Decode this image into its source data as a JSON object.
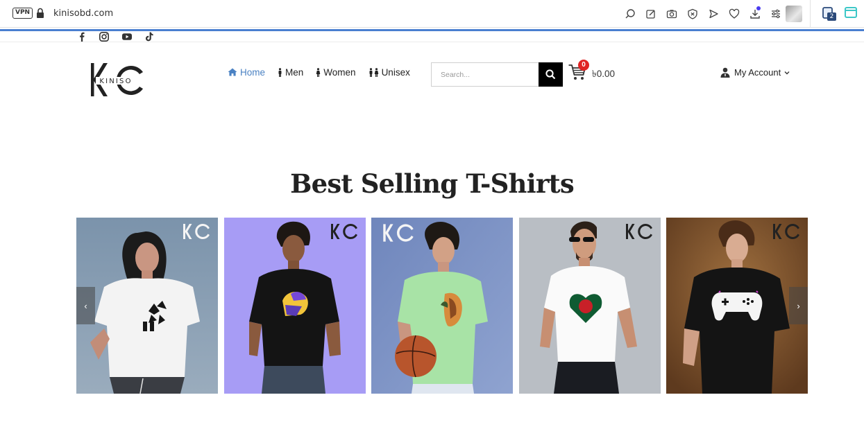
{
  "browser": {
    "vpn_label": "VPN",
    "url": "kinisobd.com",
    "tab_count": "2",
    "icons": [
      "search-page-icon",
      "edit-icon",
      "camera-icon",
      "shield-icon",
      "send-icon",
      "heart-icon",
      "download-icon",
      "settings-sliders-icon"
    ]
  },
  "social": [
    "facebook-icon",
    "instagram-icon",
    "youtube-icon",
    "tiktok-icon"
  ],
  "logo": {
    "text": "KINISO",
    "mark": "KO"
  },
  "nav": {
    "items": [
      {
        "label": "Home",
        "icon": "home-icon",
        "active": true
      },
      {
        "label": "Men",
        "icon": "man-icon",
        "active": false
      },
      {
        "label": "Women",
        "icon": "woman-icon",
        "active": false
      },
      {
        "label": "Unisex",
        "icon": "couple-icon",
        "active": false
      }
    ]
  },
  "search": {
    "placeholder": "Search..."
  },
  "cart": {
    "count": "0",
    "total": "৳0.00"
  },
  "account": {
    "label": "My Account"
  },
  "section": {
    "title": "Best Selling T-Shirts"
  },
  "products": [
    {
      "background": "#7f97ae",
      "shirt": "#f4f4f4",
      "graphic": "butterflies"
    },
    {
      "background": "#a79cf5",
      "shirt": "#151515",
      "graphic": "helmet"
    },
    {
      "background": "#7c93c4",
      "shirt": "#a8e3a6",
      "graphic": "tiger"
    },
    {
      "background": "#b9bec4",
      "shirt": "#fafafa",
      "graphic": "flag-heart"
    },
    {
      "background": "#8a5a33",
      "shirt": "#141414",
      "graphic": "gamepad"
    }
  ],
  "colors": {
    "accent": "#4b82c3",
    "badge": "#e02424",
    "dark": "#000000"
  }
}
